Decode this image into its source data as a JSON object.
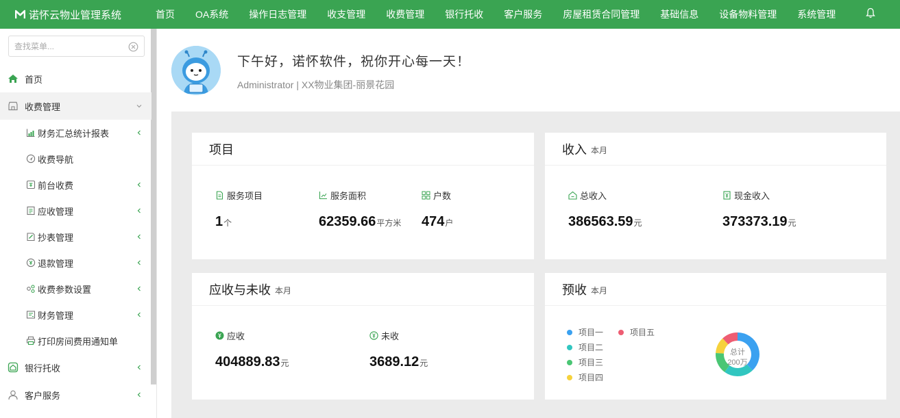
{
  "app": {
    "title": "诺怀云物业管理系统"
  },
  "topnav": [
    {
      "label": "首页"
    },
    {
      "label": "OA系统"
    },
    {
      "label": "操作日志管理"
    },
    {
      "label": "收支管理"
    },
    {
      "label": "收费管理"
    },
    {
      "label": "银行托收"
    },
    {
      "label": "客户服务"
    },
    {
      "label": "房屋租赁合同管理"
    },
    {
      "label": "基础信息"
    },
    {
      "label": "设备物料管理"
    },
    {
      "label": "系统管理"
    }
  ],
  "sidebar": {
    "search_placeholder": "查找菜单...",
    "items": [
      {
        "label": "首页",
        "icon": "home-icon"
      },
      {
        "label": "收费管理",
        "icon": "store-icon",
        "expanded": true
      },
      {
        "label": "财务汇总统计报表",
        "icon": "chart-icon"
      },
      {
        "label": "收费导航",
        "icon": "navigation-icon"
      },
      {
        "label": "前台收费",
        "icon": "cashier-icon"
      },
      {
        "label": "应收管理",
        "icon": "receivable-icon"
      },
      {
        "label": "抄表管理",
        "icon": "meter-icon"
      },
      {
        "label": "退款管理",
        "icon": "refund-icon"
      },
      {
        "label": "收费参数设置",
        "icon": "settings-icon"
      },
      {
        "label": "财务管理",
        "icon": "finance-icon"
      },
      {
        "label": "打印房间费用通知单",
        "icon": "printer-icon"
      },
      {
        "label": "银行托收",
        "icon": "bank-icon"
      },
      {
        "label": "客户服务",
        "icon": "user-icon"
      }
    ]
  },
  "greeting": {
    "title": "下午好，诺怀软件，祝你开心每一天！",
    "subtitle": "Administrator | XX物业集团-丽景花园"
  },
  "cards": {
    "project": {
      "title": "项目",
      "stats": [
        {
          "label": "服务项目",
          "value": "1",
          "unit": "个"
        },
        {
          "label": "服务面积",
          "value": "62359.66",
          "unit": "平方米"
        },
        {
          "label": "户数",
          "value": "474",
          "unit": "户"
        }
      ]
    },
    "income": {
      "title": "收入",
      "subtitle": "本月",
      "stats": [
        {
          "label": "总收入",
          "value": "386563.59",
          "unit": "元"
        },
        {
          "label": "现金收入",
          "value": "373373.19",
          "unit": "元"
        }
      ]
    },
    "receivable": {
      "title": "应收与未收",
      "subtitle": "本月",
      "stats": [
        {
          "label": "应收",
          "value": "404889.83",
          "unit": "元"
        },
        {
          "label": "未收",
          "value": "3689.12",
          "unit": "元"
        }
      ]
    },
    "prepaid": {
      "title": "预收",
      "subtitle": "本月",
      "center_label": "总计",
      "center_value": "200万"
    }
  },
  "chart_data": {
    "type": "pie",
    "categories": [
      "项目一",
      "项目二",
      "项目三",
      "项目四",
      "项目五"
    ],
    "values": [
      38,
      22,
      16,
      12,
      12
    ],
    "colors": [
      "#3ba1f0",
      "#31c6c0",
      "#4ac674",
      "#f6d23c",
      "#ee5d73"
    ],
    "center_label": "总计",
    "center_value": "200万"
  }
}
